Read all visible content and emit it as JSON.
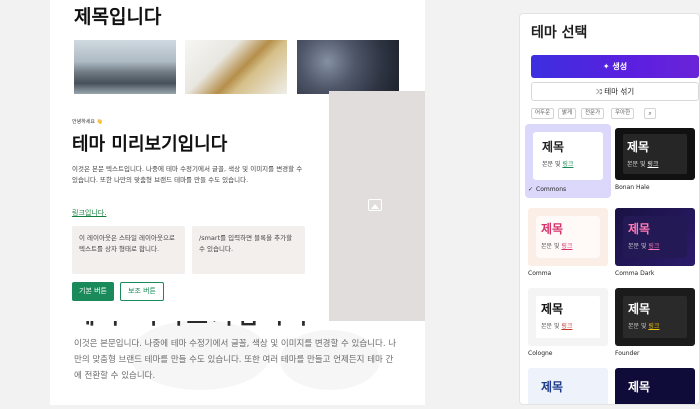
{
  "document": {
    "title": "제목입니다",
    "under_title": "테마 미리보기입니다",
    "under_text": "이것은 본문입니다. 나중에 테마 수정기에서 글꼴, 색상 및 이미지를 변경할 수 있습니다. 나만의 맞춤형 브랜드 테마를 만들 수도 있습니다. 또한 여러 테마를 만들고 언제든지 테마 간에 전환할 수 있습니다."
  },
  "preview": {
    "eyebrow": "안녕하세요 👋",
    "title": "테마 미리보기입니다",
    "body": "이것은 본문 텍스트입니다. 나중에 테마 수정기에서 글꼴, 색상 및 이미지를 변경할 수 있습니다. 또한 나만의 맞춤형 브랜드 테마를 만들 수도 있습니다.",
    "link": "링크입니다.",
    "box1": "이 레이아웃은 스타일 레이아웃으로 텍스트를 상자 형태로 합니다.",
    "box2": "/smart를 입력하면 블록을 추가할 수 있습니다.",
    "primary_button": "기본 버튼",
    "secondary_button": "보조 버튼"
  },
  "panel": {
    "title": "테마 선택",
    "generate_label": "생성",
    "mix_label": "테마 섞기",
    "chips": [
      "어두운",
      "밝게",
      "전문가",
      "우아한"
    ],
    "themes": [
      {
        "label": "Commons",
        "title": "제목",
        "sub": "본문 및",
        "link": "링크",
        "selected": true,
        "check": "✓"
      },
      {
        "label": "Bonan Hale",
        "title": "제목",
        "sub": "본문 및",
        "link": "링크"
      },
      {
        "label": "Comma",
        "title": "제목",
        "sub": "본문 및",
        "link": "링크"
      },
      {
        "label": "Comma Dark",
        "title": "제목",
        "sub": "본문 및",
        "link": "링크"
      },
      {
        "label": "Cologne",
        "title": "제목",
        "sub": "본문 및",
        "link": "링크"
      },
      {
        "label": "Founder",
        "title": "제목",
        "sub": "본문 및",
        "link": "링크"
      },
      {
        "label": "",
        "title": "제목",
        "sub": "",
        "link": ""
      },
      {
        "label": "",
        "title": "제목",
        "sub": "",
        "link": ""
      }
    ]
  },
  "colors": {
    "accent_primary": "#1b8a5a",
    "generate_gradient_start": "#3d2fe0",
    "generate_gradient_end": "#6a24d8",
    "selected_card": "#dcd8fb"
  },
  "icons": {
    "generate": "sparkle-icon",
    "mix": "shuffle-icon",
    "search": "search-icon",
    "image": "image-icon"
  }
}
